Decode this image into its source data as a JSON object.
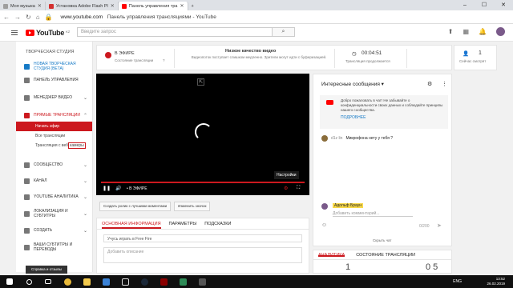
{
  "browser": {
    "tabs": [
      {
        "label": "Моя музыка",
        "color": "#e6e6e6"
      },
      {
        "label": "Установка Adobe Flash Pl",
        "color": "#d32f2f"
      },
      {
        "label": "Панель управления тра",
        "color": "#ff0000"
      }
    ],
    "new_tab": "+",
    "url_host": "www.youtube.com",
    "url_rest": "Панель управления трансляциями - YouTube"
  },
  "header": {
    "logo": "YouTube",
    "region": "KZ",
    "search_placeholder": "Введите запрос"
  },
  "sidebar": {
    "title": "ТВОРЧЕСКАЯ СТУДИЯ",
    "new_studio": "НОВАЯ ТВОРЧЕСКАЯ СТУДИЯ (BETA)",
    "items": [
      "ПАНЕЛЬ УПРАВЛЕНИЯ",
      "МЕНЕДЖЕР ВИДЕО",
      "ПРЯМЫЕ ТРАНСЛЯЦИИ"
    ],
    "subitems": [
      "Начать эфир",
      "Все трансляции",
      "Трансляция с веб"
    ],
    "webcam_highlight": "камеры",
    "items2": [
      "СООБЩЕСТВО",
      "КАНАЛ",
      "YOUTUBE АНАЛИТИКА",
      "ЛОКАЛИЗАЦИЯ И СУБТИТРЫ",
      "СОЗДАТЬ",
      "ВАШИ СУБТИТРЫ И ПЕРЕВОДЫ"
    ],
    "help": "Справка и отзывы"
  },
  "status": {
    "live": "В ЭФИРЕ",
    "live_sub": "Состояние трансляции",
    "quality_title": "Низкое качество видео",
    "quality_desc": "Видеопоток поступает слишком медленно. Зрители могут идти с буферизацией.",
    "timer": "00:04:51",
    "timer_sub": "Трансляция продолжается",
    "viewers": "1",
    "viewers_sub": "Сейчас смотрят"
  },
  "player": {
    "live_label": "• В ЭФИРЕ",
    "settings_tooltip": "Настройки"
  },
  "buttons": {
    "clip": "Создать ролик с лучшими моментами",
    "thumb": "Изменить значок"
  },
  "infotabs": {
    "tabs": [
      "ОСНОВНАЯ ИНФОРМАЦИЯ",
      "ПАРАМЕТРЫ",
      "ПОДСКАЗКИ"
    ],
    "title_value": "Учусь играть в Free Fire",
    "desc_placeholder": "Добавить описание"
  },
  "chat": {
    "title": "Интересные сообщения",
    "welcome": "Добро пожаловать в чат! Не забывайте о конфиденциальности своих данных и соблюдайте принципы нашего сообщества.",
    "more": "ПОДРОБНЕЕ",
    "msg_user": "d1z lin",
    "msg_text": "Микрофона нету у тебя ?",
    "me": "Адольф Браун",
    "comment_placeholder": "Добавить комментарий...",
    "counter": "0/200",
    "hide": "Скрыть чат"
  },
  "analytics": {
    "tabs": [
      "АНАЛИТИКА",
      "СОСТОЯНИЕ ТРАНСЛЯЦИИ"
    ],
    "nums": [
      "1",
      "0 5"
    ]
  },
  "taskbar": {
    "lang": "ENG",
    "time": "13:52",
    "date": "26.02.2019"
  }
}
